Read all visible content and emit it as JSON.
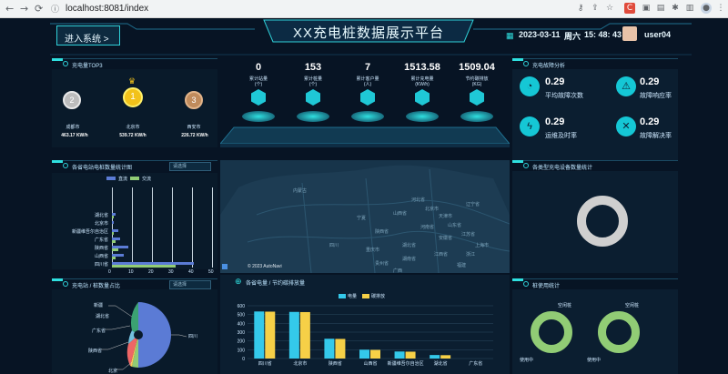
{
  "browser": {
    "url": "localhost:8081/index",
    "back": "←",
    "forward": "→",
    "reload": "⟳",
    "info": "ⓘ"
  },
  "header": {
    "enter_btn": "进入系统 >",
    "title": "XX充电桩数据展示平台",
    "date": "2023-03-11",
    "weekday": "周六",
    "time": "15: 48: 43",
    "user": "user04"
  },
  "top3": {
    "title": "充电量TOP3",
    "items": [
      {
        "rank": "2",
        "city": "成都市",
        "value": "463.17 KW/h"
      },
      {
        "rank": "1",
        "city": "北京市",
        "value": "539.72 KW/h"
      },
      {
        "rank": "3",
        "city": "西安市",
        "value": "226.72 KW/h"
      }
    ]
  },
  "stats": [
    {
      "value": "0",
      "label": "累计站量\n(个)"
    },
    {
      "value": "153",
      "label": "累计桩量\n(个)"
    },
    {
      "value": "7",
      "label": "累计客户量\n(人)"
    },
    {
      "value": "1513.58",
      "label": "累计充电量\n(KW/h)"
    },
    {
      "value": "1509.04",
      "label": "节约碳排放\n(KG)"
    }
  ],
  "fault": {
    "title": "充电故障分析",
    "items": [
      {
        "value": "0.29",
        "label": "平均故障次数",
        "icon": "pie-icon"
      },
      {
        "value": "0.29",
        "label": "故障响应率",
        "icon": "alarm-icon"
      },
      {
        "value": "0.29",
        "label": "运维及时率",
        "icon": "lightning-icon"
      },
      {
        "value": "0.29",
        "label": "故障解决率",
        "icon": "tools-icon"
      }
    ]
  },
  "province": {
    "title": "各省电站电桩数量统计图",
    "select": "请选择",
    "legend": [
      "直流",
      "交流"
    ],
    "categories": [
      "湖北省",
      "北京市",
      "新疆维吾尔自治区",
      "广东省",
      "陕西省",
      "山西省",
      "四川省"
    ],
    "ticks": [
      "0",
      "10",
      "20",
      "30",
      "40",
      "50"
    ]
  },
  "map": {
    "attribution": "© 2023 AutoNavi",
    "labels": [
      "内蒙古",
      "河北省",
      "山西省",
      "北京市",
      "天津市",
      "辽宁省",
      "宁夏",
      "陕西省",
      "河南省",
      "山东省",
      "湖北省",
      "安徽省",
      "江苏省",
      "上海市",
      "重庆市",
      "湖南省",
      "浙江",
      "四川",
      "江西省",
      "贵州省",
      "广西",
      "福建"
    ]
  },
  "type_stat": {
    "title": "各类型充电设备数量统计"
  },
  "ratio": {
    "title": "充电站 / 桩数量占比",
    "select": "请选择",
    "labels": [
      "湖北省",
      "新疆",
      "广东省",
      "陕西省",
      "北京",
      "四川"
    ]
  },
  "energy": {
    "title": "各省电量 / 节约碳排放量",
    "legend": [
      "电量",
      "碳排放"
    ],
    "yticks": [
      "600",
      "500",
      "400",
      "300",
      "200",
      "100",
      "0"
    ]
  },
  "usage": {
    "title": "桩使用统计",
    "labels": [
      "空闲桩",
      "使用中",
      "空闲桩",
      "使用中"
    ]
  },
  "chart_data": {
    "type": "bar",
    "title": "各省电量 / 节约碳排放量",
    "categories": [
      "四川省",
      "北京市",
      "陕西省",
      "山西省",
      "新疆维吾尔自治区",
      "湖北省",
      "广东省"
    ],
    "series": [
      {
        "name": "电量",
        "values": [
          535,
          530,
          225,
          100,
          80,
          40,
          0
        ]
      },
      {
        "name": "碳排放",
        "values": [
          533,
          528,
          223,
          98,
          78,
          38,
          0
        ]
      }
    ],
    "ylim": [
      0,
      600
    ]
  },
  "colors": {
    "accent": "#2fe0e0",
    "series1": "#34c9ea",
    "series2": "#f6d047",
    "gold": "#f2c21a",
    "silver": "#b9b9b9",
    "bronze": "#c08b5c"
  }
}
